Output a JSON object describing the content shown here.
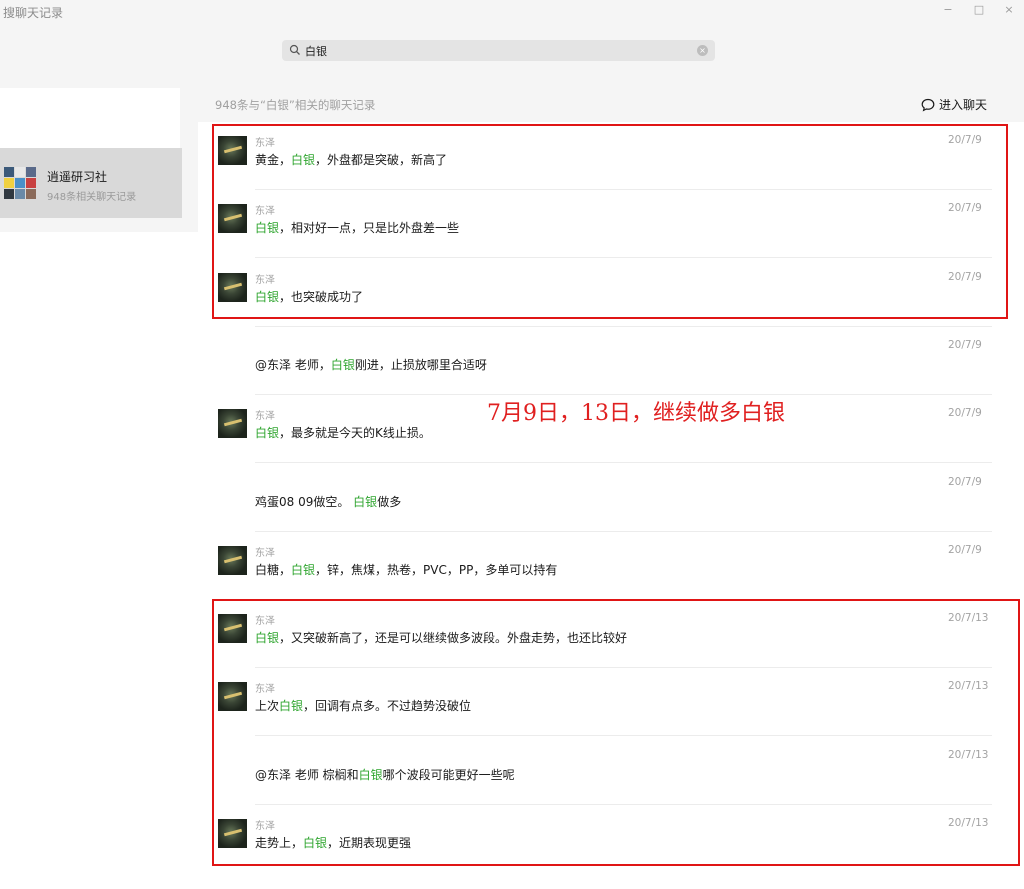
{
  "window": {
    "title": "搜聊天记录",
    "minimize": "−",
    "maximize": "□",
    "close": "×"
  },
  "search": {
    "value": "白银"
  },
  "sidebar": {
    "items": [
      {
        "name": "逍遥研习社",
        "subtitle": "948条相关聊天记录"
      }
    ]
  },
  "results": {
    "header": "948条与“白银”相关的聊天记录",
    "enter_chat": "进入聊天",
    "messages": [
      {
        "sender": "东泽",
        "date": "20/7/9",
        "parts": [
          "黄金，",
          "白银",
          "，外盘都是突破，新高了"
        ],
        "avatar": "photo"
      },
      {
        "sender": "东泽",
        "date": "20/7/9",
        "parts": [
          "",
          "白银",
          "，相对好一点，只是比外盘差一些"
        ],
        "avatar": "photo"
      },
      {
        "sender": "东泽",
        "date": "20/7/9",
        "parts": [
          "",
          "白银",
          "，也突破成功了"
        ],
        "avatar": "photo"
      },
      {
        "sender": "",
        "date": "20/7/9",
        "parts": [
          "@东泽 老师，",
          "白银",
          "刚进，止损放哪里合适呀"
        ],
        "avatar": "blank"
      },
      {
        "sender": "东泽",
        "date": "20/7/9",
        "parts": [
          "",
          "白银",
          "，最多就是今天的K线止损。"
        ],
        "avatar": "photo"
      },
      {
        "sender": "",
        "date": "20/7/9",
        "parts": [
          "鸡蛋08 09做空。 ",
          "白银",
          "做多"
        ],
        "avatar": "blank"
      },
      {
        "sender": "东泽",
        "date": "20/7/9",
        "parts": [
          "白糖，",
          "白银",
          "，锌，焦煤，热卷，PVC，PP，多单可以持有"
        ],
        "avatar": "photo"
      },
      {
        "sender": "东泽",
        "date": "20/7/13",
        "parts": [
          "",
          "白银",
          "，又突破新高了，还是可以继续做多波段。外盘走势，也还比较好"
        ],
        "avatar": "photo"
      },
      {
        "sender": "东泽",
        "date": "20/7/13",
        "parts": [
          "上次",
          "白银",
          "，回调有点多。不过趋势没破位"
        ],
        "avatar": "photo"
      },
      {
        "sender": "",
        "date": "20/7/13",
        "parts": [
          "@东泽 老师 棕榈和",
          "白银",
          "哪个波段可能更好一些呢"
        ],
        "avatar": "blank"
      },
      {
        "sender": "东泽",
        "date": "20/7/13",
        "parts": [
          "走势上，",
          "白银",
          "，近期表现更强"
        ],
        "avatar": "photo"
      }
    ]
  },
  "annotation": {
    "text": "7月9日，13日，继续做多白银",
    "color": "#e02020"
  },
  "colors": {
    "highlight": "#2fa52f",
    "annotation_box": "#e01515"
  }
}
